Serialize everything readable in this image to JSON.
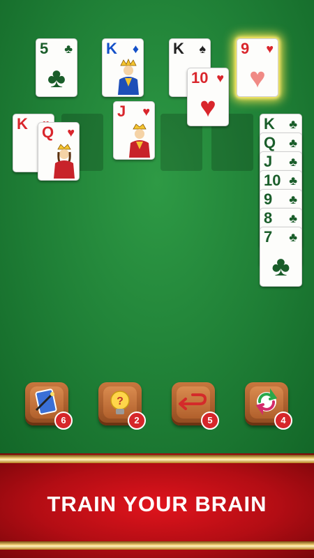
{
  "foundations": [
    {
      "rank": "5",
      "suit": "♣"
    },
    {
      "rank": "K",
      "suit": "♦"
    },
    {
      "rank": "K",
      "suit": "♠"
    },
    {
      "rank": "9",
      "suit": "♥"
    }
  ],
  "moving_card": {
    "rank": "10",
    "suit": "♥"
  },
  "left_stack": [
    {
      "rank": "K",
      "suit": "♥"
    },
    {
      "rank": "Q",
      "suit": "♥"
    }
  ],
  "jack_card": {
    "rank": "J",
    "suit": "♥"
  },
  "right_column": [
    {
      "rank": "K",
      "suit": "♣"
    },
    {
      "rank": "Q",
      "suit": "♣"
    },
    {
      "rank": "J",
      "suit": "♣"
    },
    {
      "rank": "10",
      "suit": "♣"
    },
    {
      "rank": "9",
      "suit": "♣"
    },
    {
      "rank": "8",
      "suit": "♣"
    },
    {
      "rank": "7",
      "suit": "♣"
    }
  ],
  "tools": [
    {
      "icon": "magic-wand-card-icon",
      "count": "6"
    },
    {
      "icon": "hint-lightbulb-icon",
      "count": "2"
    },
    {
      "icon": "undo-arrow-icon",
      "count": "5"
    },
    {
      "icon": "shuffle-refresh-icon",
      "count": "4"
    }
  ],
  "banner": {
    "text": "TRAIN YOUR BRAIN"
  },
  "colors": {
    "felt": "#1f7f36",
    "banner": "#c8101a",
    "gold": "#f6d67a",
    "badge": "#d6262a",
    "hearts": "#d9262c",
    "clubs": "#1a5d2a",
    "diamonds": "#1450c8"
  }
}
